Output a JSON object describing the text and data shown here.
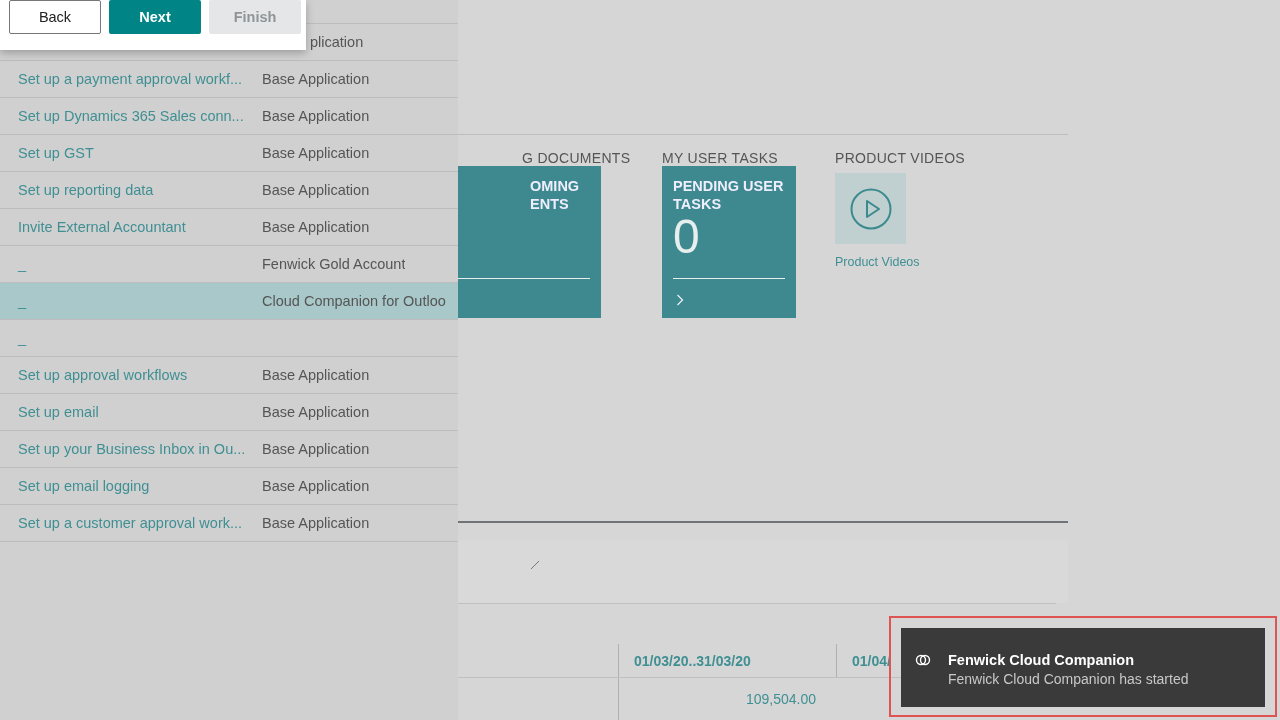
{
  "wizard": {
    "buttons": [
      {
        "label": "Back",
        "kind": "secondary",
        "disabled": false
      },
      {
        "label": "Next",
        "kind": "primary",
        "disabled": false
      },
      {
        "label": "Finish",
        "kind": "primary",
        "disabled": true
      }
    ]
  },
  "setup_list": {
    "rows": [
      {
        "app": "plication",
        "kind": "partial",
        "selected": false
      },
      {
        "name": "Set up a payment approval workf...",
        "app": "Base Application",
        "kind": "row",
        "selected": false
      },
      {
        "name": "Set up Dynamics 365 Sales conn...",
        "app": "Base Application",
        "kind": "row",
        "selected": false
      },
      {
        "name": "Set up GST",
        "app": "Base Application",
        "kind": "row",
        "selected": false
      },
      {
        "name": "Set up reporting data",
        "app": "Base Application",
        "kind": "row",
        "selected": false
      },
      {
        "name": "Invite External Accountant",
        "app": "Base Application",
        "kind": "row",
        "selected": false
      },
      {
        "name": "_",
        "app": "Fenwick Gold Account",
        "kind": "row",
        "selected": false
      },
      {
        "name": "_",
        "app": "Cloud Companion for Outloo",
        "kind": "row",
        "selected": true
      },
      {
        "name": "_",
        "kind": "row",
        "selected": false
      },
      {
        "name": "Set up approval workflows",
        "app": "Base Application",
        "kind": "row",
        "selected": false
      },
      {
        "name": "Set up email",
        "app": "Base Application",
        "kind": "row",
        "selected": false
      },
      {
        "name": "Set up your Business Inbox in Ou...",
        "app": "Base Application",
        "kind": "row",
        "selected": false
      },
      {
        "name": "Set up email logging",
        "app": "Base Application",
        "kind": "row",
        "selected": false
      },
      {
        "name": "Set up a customer approval work...",
        "app": "Base Application",
        "kind": "row",
        "selected": false
      }
    ]
  },
  "dashboard": {
    "parts": [
      {
        "kind": "cut_tile",
        "heading": "G DOCUMENTS",
        "title_lines": [
          "OMING",
          "ENTS"
        ]
      },
      {
        "kind": "tile",
        "heading": "MY USER TASKS",
        "title_lines": [
          "PENDING USER",
          "TASKS"
        ],
        "value": "0"
      },
      {
        "kind": "video",
        "heading": "PRODUCT VIDEOS",
        "link": "Product Videos"
      }
    ]
  },
  "table": {
    "columns": [
      "01/03/20..31/03/20",
      "01/04/"
    ],
    "rows": [
      [
        "109,504.00"
      ]
    ]
  },
  "toast": {
    "title": "Fenwick Cloud Companion",
    "message": "Fenwick Cloud Companion has started",
    "highlighted": true
  }
}
